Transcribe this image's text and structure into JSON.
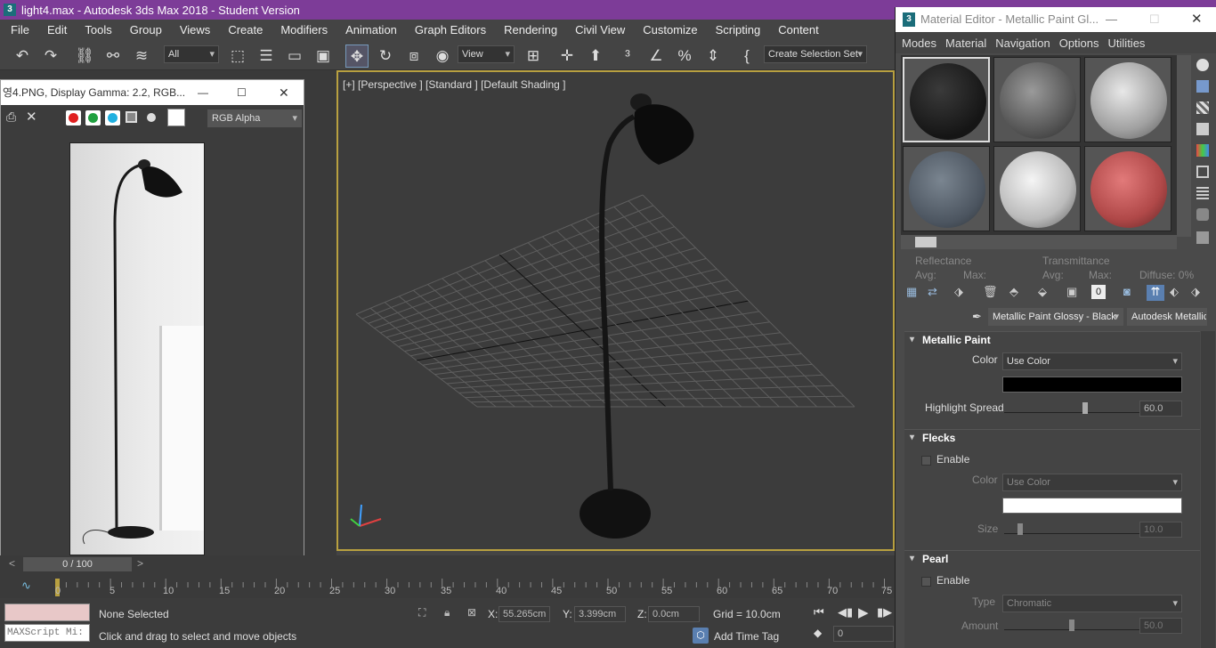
{
  "window": {
    "title": "light4.max - Autodesk 3ds Max 2018 - Student Version",
    "logo": "3"
  },
  "menu": [
    "File",
    "Edit",
    "Tools",
    "Group",
    "Views",
    "Create",
    "Modifiers",
    "Animation",
    "Graph Editors",
    "Rendering",
    "Civil View",
    "Customize",
    "Scripting",
    "Content"
  ],
  "toolbar": {
    "filter": "All",
    "ref_coord": "View",
    "selection_set": "Create Selection Set"
  },
  "viewport": {
    "label": "[+] [Perspective ] [Standard ] [Default Shading ]"
  },
  "frame_window": {
    "title": "영4.PNG, Display Gamma: 2.2, RGB...",
    "channel": "RGB Alpha",
    "minimize": "—",
    "maximize": "☐",
    "close": "✕"
  },
  "timeline": {
    "frame_counter": "0 / 100",
    "ticks": [
      "0",
      "5",
      "10",
      "15",
      "20",
      "25",
      "30",
      "35",
      "40",
      "45",
      "50",
      "55",
      "60",
      "65",
      "70",
      "75"
    ]
  },
  "status": {
    "selection": "None Selected",
    "prompt": "Click and drag to select and move objects",
    "maxscript_placeholder": "MAXScript Mi:",
    "x_label": "X:",
    "x_value": "55.265cm",
    "y_label": "Y:",
    "y_value": "3.399cm",
    "z_label": "Z:",
    "z_value": "0.0cm",
    "grid": "Grid = 10.0cm",
    "add_time_tag": "Add Time Tag",
    "frame_field": "0"
  },
  "material_editor": {
    "title": "Material Editor - Metallic Paint Gl...",
    "logo": "3",
    "menu": [
      "Modes",
      "Material",
      "Navigation",
      "Options",
      "Utilities"
    ],
    "reflectance_label": "Reflectance",
    "refl_avg": "Avg:",
    "refl_max": "Max:",
    "transmittance_label": "Transmittance",
    "trans_avg": "Avg:",
    "trans_max": "Max:",
    "diffuse": "Diffuse:  0%",
    "material_name": "Metallic Paint Glossy - Black",
    "material_type": "Autodesk Metallic Paint",
    "rollouts": {
      "metallic_paint": {
        "title": "Metallic Paint",
        "color_label": "Color",
        "color_option": "Use Color",
        "swatch": "#000000",
        "highlight_label": "Highlight Spread",
        "highlight_value": "60.0",
        "highlight_fraction": 0.6
      },
      "flecks": {
        "title": "Flecks",
        "enable": "Enable",
        "color_label": "Color",
        "color_option": "Use Color",
        "swatch": "#ffffff",
        "size_label": "Size",
        "size_value": "10.0",
        "size_fraction": 0.1
      },
      "pearl": {
        "title": "Pearl",
        "enable": "Enable",
        "type_label": "Type",
        "type_option": "Chromatic",
        "amount_label": "Amount",
        "amount_value": "50.0",
        "amount_fraction": 0.5
      }
    }
  },
  "icons": [
    "undo-icon",
    "redo-icon",
    "link-icon",
    "unlink-icon",
    "bind-space-warp-icon",
    "select-object-icon",
    "select-by-name-icon",
    "rect-region-icon",
    "window-crossing-icon",
    "move-icon",
    "rotate-icon",
    "scale-icon",
    "place-icon",
    "pivot-icon",
    "mirror-icon",
    "align-icon",
    "snap-3d-icon",
    "angle-snap-icon",
    "percent-snap-icon",
    "spinner-snap-icon",
    "edit-named-selection-icon"
  ]
}
